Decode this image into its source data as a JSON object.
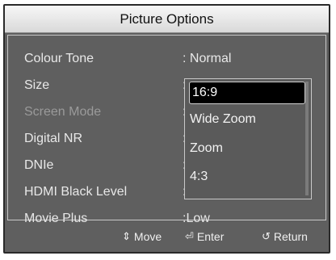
{
  "title": "Picture Options",
  "menu": [
    {
      "label": "Colour Tone",
      "value": ": Normal",
      "dim": false
    },
    {
      "label": "Size",
      "value": ":",
      "dim": false
    },
    {
      "label": "Screen Mode",
      "value": ":",
      "dim": true
    },
    {
      "label": "Digital NR",
      "value": ":",
      "dim": false
    },
    {
      "label": "DNIe",
      "value": ":",
      "dim": false
    },
    {
      "label": "HDMI Black Level",
      "value": ":",
      "dim": false
    },
    {
      "label": "Movie Plus",
      "value": ":Low",
      "dim": false
    }
  ],
  "dropdown": {
    "options": [
      "16:9",
      "Wide Zoom",
      "Zoom",
      "4:3"
    ],
    "selected_index": 0
  },
  "footer": {
    "move": "Move",
    "enter": "Enter",
    "return": "Return",
    "icons": {
      "move": "updown-arrows-icon",
      "enter": "enter-icon",
      "return": "return-arrow-icon"
    }
  }
}
